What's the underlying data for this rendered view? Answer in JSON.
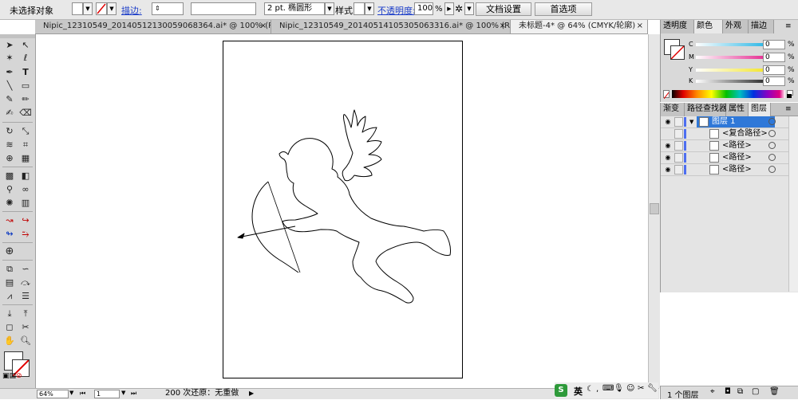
{
  "control_bar": {
    "selection_status": "未选择对象",
    "stroke_label": "描边:",
    "brush_value": "2 pt. 椭圆形",
    "style_label": "样式:",
    "opacity_label": "不透明度:",
    "opacity_value": "100",
    "opacity_unit": "%",
    "doc_setup_button": "文档设置",
    "preferences_button": "首选项"
  },
  "tabs": [
    {
      "label": "Nipic_12310549_20140512130059068364.ai* @ 100% (R...",
      "close": "×"
    },
    {
      "label": "Nipic_12310549_20140514105305063316.ai* @ 100% (R...",
      "close": "×"
    },
    {
      "label": "未标题-4* @ 64% (CMYK/轮廓)",
      "close": "×"
    }
  ],
  "color_panel": {
    "tabs": [
      "透明度",
      "颜色",
      "外观",
      "描边"
    ],
    "active_tab": "颜色",
    "sliders": [
      {
        "label": "C",
        "value": "0",
        "unit": "%",
        "color": "#00a8e0"
      },
      {
        "label": "M",
        "value": "0",
        "unit": "%",
        "color": "#e0007a"
      },
      {
        "label": "Y",
        "value": "0",
        "unit": "%",
        "color": "#f0e000"
      },
      {
        "label": "K",
        "value": "0",
        "unit": "%",
        "color": "#000000"
      }
    ]
  },
  "layers_panel": {
    "tabs": [
      "渐变",
      "路径查找器",
      "属性",
      "图层"
    ],
    "active_tab": "图层",
    "layers": [
      {
        "name": "图层 1",
        "selected": true,
        "visible": false
      },
      {
        "name": "<复合路径>",
        "selected": false,
        "visible": false
      },
      {
        "name": "<路径>",
        "selected": false,
        "visible": true
      },
      {
        "name": "<路径>",
        "selected": false,
        "visible": true
      },
      {
        "name": "<路径>",
        "selected": false,
        "visible": true
      }
    ],
    "footer_count": "1 个图层"
  },
  "status_bar": {
    "zoom": "64%",
    "artboard_index": "1",
    "undo_status": "200 次还原：无重做"
  },
  "tray": {
    "ime_label": "英"
  }
}
